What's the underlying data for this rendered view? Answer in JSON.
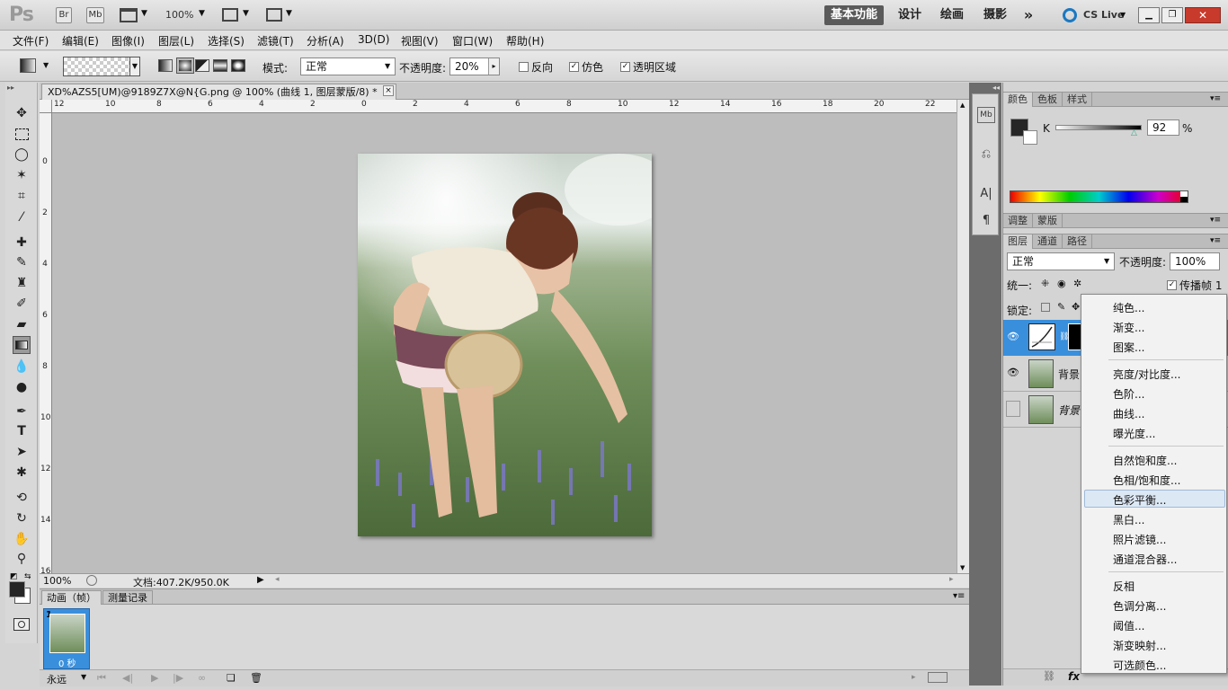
{
  "app": {
    "logo": "Ps",
    "br": "Br",
    "mb": "Mb",
    "zoom": "100%",
    "cslive": "CS Live",
    "workspaces": [
      "基本功能",
      "设计",
      "绘画",
      "摄影"
    ],
    "more": "»"
  },
  "menubar": [
    "文件(F)",
    "编辑(E)",
    "图像(I)",
    "图层(L)",
    "选择(S)",
    "滤镜(T)",
    "分析(A)",
    "3D(D)",
    "视图(V)",
    "窗口(W)",
    "帮助(H)"
  ],
  "options": {
    "mode_label": "模式:",
    "mode_value": "正常",
    "opacity_label": "不透明度:",
    "opacity_value": "20%",
    "reverse": "反向",
    "dither": "仿色",
    "transparency": "透明区域"
  },
  "document": {
    "tab_title": "XD%AZS5[UM)@9189Z7X@N{G.png @ 100% (曲线 1, 图层蒙版/8) *",
    "close": "×",
    "zoom": "100%",
    "doc_info": "文档:407.2K/950.0K",
    "ruler_h": [
      "12",
      "10",
      "8",
      "6",
      "4",
      "2",
      "0",
      "2",
      "4",
      "6",
      "8",
      "10",
      "12",
      "14",
      "16",
      "18",
      "20",
      "22"
    ],
    "ruler_v": [
      "0",
      "2",
      "4",
      "6",
      "8",
      "10",
      "12",
      "14",
      "16"
    ]
  },
  "animation": {
    "tabs": [
      "动画（帧）",
      "测量记录"
    ],
    "frame_number": "1",
    "frame_time": "0 秒",
    "loop": "永远"
  },
  "color_panel": {
    "tabs": [
      "颜色",
      "色板",
      "样式"
    ],
    "channel": "K",
    "value": "92",
    "unit": "%"
  },
  "adjust_panel": {
    "tabs": [
      "调整",
      "蒙版"
    ]
  },
  "layers_panel": {
    "tabs": [
      "图层",
      "通道",
      "路径"
    ],
    "blend": "正常",
    "opacity_label": "不透明度:",
    "opacity_value": "100%",
    "unify_label": "统一:",
    "propagate": "传播帧 1",
    "lock_label": "锁定:",
    "layers": [
      {
        "name": ""
      },
      {
        "name": "背景"
      },
      {
        "name": "背景"
      }
    ],
    "fx": "fx"
  },
  "dropdown_menu": {
    "groups": [
      [
        "纯色...",
        "渐变...",
        "图案..."
      ],
      [
        "亮度/对比度...",
        "色阶...",
        "曲线...",
        "曝光度..."
      ],
      [
        "自然饱和度...",
        "色相/饱和度...",
        "色彩平衡...",
        "黑白...",
        "照片滤镜...",
        "通道混合器..."
      ],
      [
        "反相",
        "色调分离...",
        "阈值...",
        "渐变映射...",
        "可选颜色..."
      ]
    ],
    "highlighted": "色彩平衡..."
  },
  "colors": {
    "accent": "#3a8fdc",
    "menu_highlight": "#dde8f5",
    "foreground": "#262626",
    "background": "#ffffff"
  }
}
